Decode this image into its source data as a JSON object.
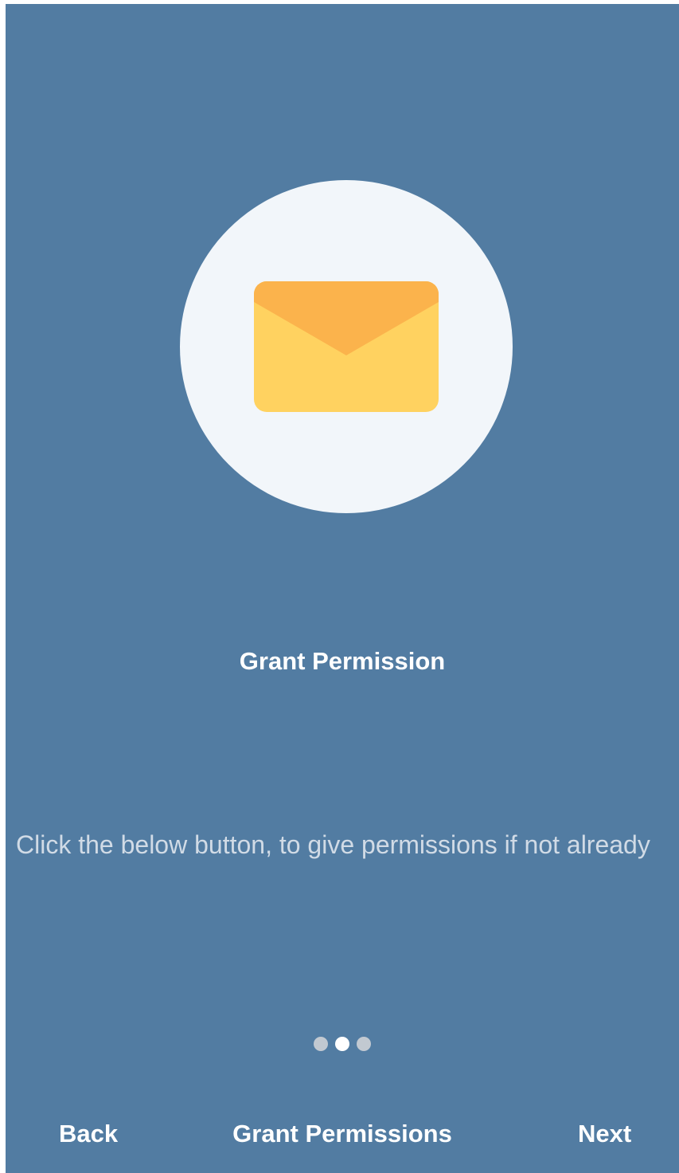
{
  "intro": {
    "title": "Grant Permission",
    "description": "Click the below button, to give permissions if not already",
    "illustration_icon": "envelope-icon"
  },
  "pager": {
    "count": 3,
    "active_index": 1
  },
  "footer": {
    "back_label": "Back",
    "grant_label": "Grant Permissions",
    "next_label": "Next"
  },
  "colors": {
    "background": "#527ca2",
    "circle": "#f2f6fa",
    "envelope_body": "#ffd260",
    "envelope_flap": "#fbb34c",
    "dot_inactive": "#c2c9d1",
    "dot_active": "#ffffff"
  }
}
